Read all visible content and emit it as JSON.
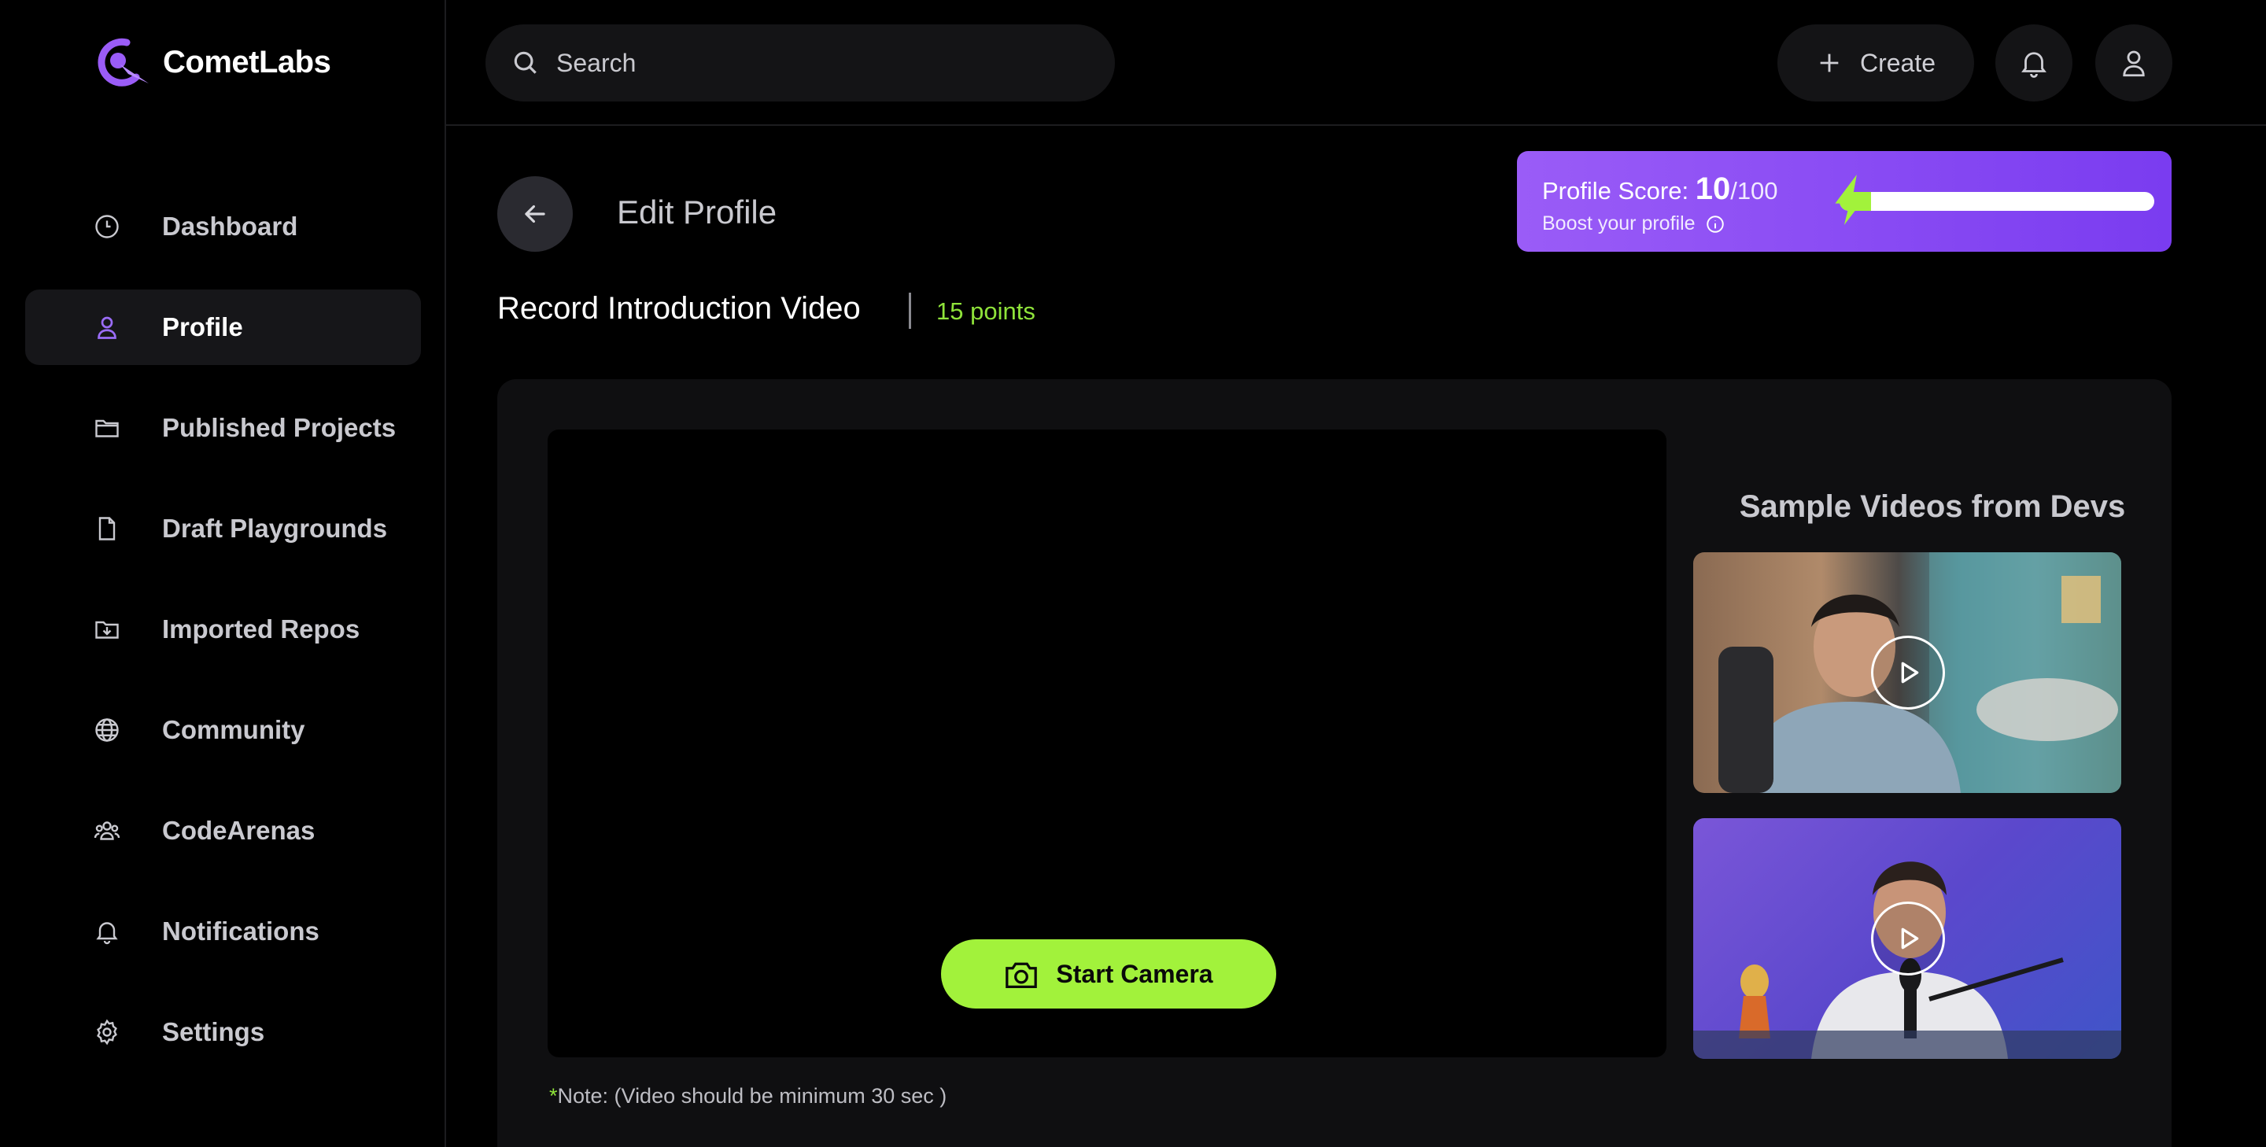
{
  "app": {
    "name": "CometLabs"
  },
  "sidebar": {
    "items": [
      {
        "label": "Dashboard",
        "icon": "clock-icon",
        "active": false
      },
      {
        "label": "Profile",
        "icon": "user-icon",
        "active": true
      },
      {
        "label": "Published Projects",
        "icon": "folder-icon",
        "active": false
      },
      {
        "label": "Draft Playgrounds",
        "icon": "file-icon",
        "active": false
      },
      {
        "label": "Imported Repos",
        "icon": "folder-download-icon",
        "active": false
      },
      {
        "label": "Community",
        "icon": "globe-icon",
        "active": false
      },
      {
        "label": "CodeArenas",
        "icon": "users-icon",
        "active": false
      },
      {
        "label": "Notifications",
        "icon": "bell-icon",
        "active": false
      },
      {
        "label": "Settings",
        "icon": "gear-icon",
        "active": false
      }
    ]
  },
  "topbar": {
    "search_placeholder": "Search",
    "create_label": "Create"
  },
  "page": {
    "title": "Edit Profile",
    "section_title": "Record Introduction Video",
    "points": "15 points"
  },
  "score": {
    "label": "Profile Score:",
    "value": "10",
    "max": "/100",
    "fraction": 0.1,
    "boost_text": "Boost your profile"
  },
  "recorder": {
    "start_camera_label": "Start Camera",
    "note_asterisk": "*",
    "note_text": "Note: (Video should be minimum 30 sec )"
  },
  "samples": {
    "title": "Sample Videos from Devs"
  },
  "colors": {
    "accent_green": "#a2f23b",
    "accent_purple": "#8b4ff5",
    "points_green": "#8fe33a"
  }
}
